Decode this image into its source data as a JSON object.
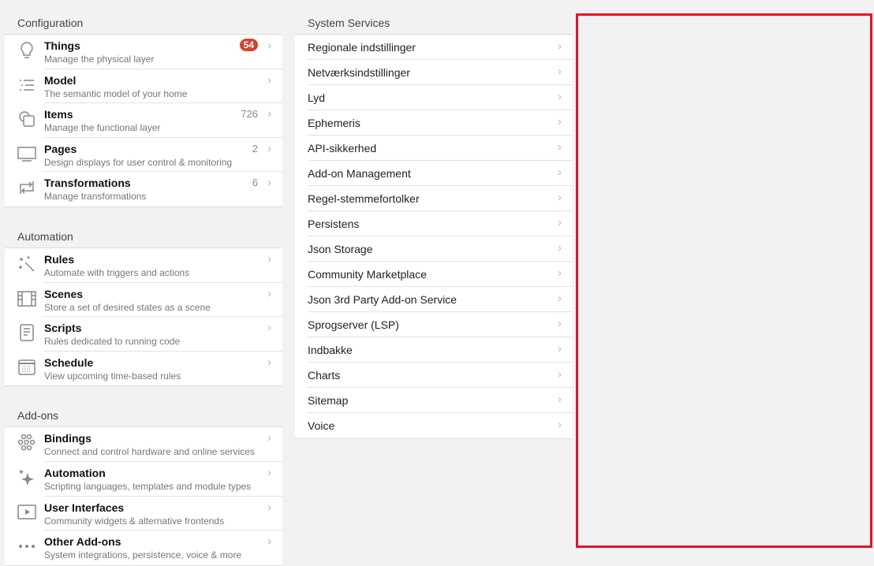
{
  "sections": [
    {
      "title": "Configuration",
      "items": [
        {
          "icon": "lightbulb-icon",
          "title": "Things",
          "subtitle": "Manage the physical layer",
          "badge": "54"
        },
        {
          "icon": "list-icon",
          "title": "Model",
          "subtitle": "The semantic model of your home"
        },
        {
          "icon": "items-icon",
          "title": "Items",
          "subtitle": "Manage the functional layer",
          "count": "726"
        },
        {
          "icon": "monitor-icon",
          "title": "Pages",
          "subtitle": "Design displays for user control & monitoring",
          "count": "2"
        },
        {
          "icon": "transform-icon",
          "title": "Transformations",
          "subtitle": "Manage transformations",
          "count": "6"
        }
      ]
    },
    {
      "title": "Automation",
      "items": [
        {
          "icon": "wand-icon",
          "title": "Rules",
          "subtitle": "Automate with triggers and actions"
        },
        {
          "icon": "film-icon",
          "title": "Scenes",
          "subtitle": "Store a set of desired states as a scene"
        },
        {
          "icon": "script-icon",
          "title": "Scripts",
          "subtitle": "Rules dedicated to running code"
        },
        {
          "icon": "calendar-icon",
          "title": "Schedule",
          "subtitle": "View upcoming time-based rules"
        }
      ]
    },
    {
      "title": "Add-ons",
      "items": [
        {
          "icon": "bindings-icon",
          "title": "Bindings",
          "subtitle": "Connect and control hardware and online services"
        },
        {
          "icon": "sparkle-icon",
          "title": "Automation",
          "subtitle": "Scripting languages, templates and module types"
        },
        {
          "icon": "play-icon",
          "title": "User Interfaces",
          "subtitle": "Community widgets & alternative frontends"
        },
        {
          "icon": "more-icon",
          "title": "Other Add-ons",
          "subtitle": "System integrations, persistence, voice & more"
        }
      ]
    }
  ],
  "system_services": {
    "title": "System Services",
    "items": [
      "Regionale indstillinger",
      "Netværksindstillinger",
      "Lyd",
      "Ephemeris",
      "API-sikkerhed",
      "Add-on Management",
      "Regel-stemmefortolker",
      "Persistens",
      "Json Storage",
      "Community Marketplace",
      "Json 3rd Party Add-on Service",
      "Sprogserver (LSP)",
      "Indbakke",
      "Charts",
      "Sitemap",
      "Voice"
    ]
  },
  "highlight_color": "#e81123"
}
